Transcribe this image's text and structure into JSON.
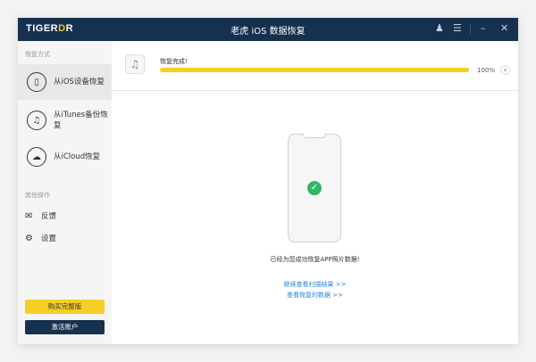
{
  "titlebar": {
    "logo": "TIGER",
    "logo_accent": "D",
    "logo_end": "R",
    "title": "老虎 iOS 数据恢复",
    "user_icon": "user-icon",
    "menu_icon": "menu-icon",
    "min": "–",
    "close": "✕"
  },
  "sidebar": {
    "section1": "恢复方式",
    "items": [
      {
        "label": "从iOS设备恢复",
        "icon": "phone-icon"
      },
      {
        "label": "从iTunes备份恢复",
        "icon": "music-icon"
      },
      {
        "label": "从iCloud恢复",
        "icon": "cloud-icon"
      }
    ],
    "section2": "其他操作",
    "ops": [
      {
        "label": "反馈"
      },
      {
        "label": "设置"
      }
    ],
    "buy": "购买完整版",
    "activate": "激活账户"
  },
  "progress": {
    "label": "恢复完成!",
    "percent": 100,
    "percent_text": "100%"
  },
  "result": {
    "message": "已经为您成功恢复APP照片数据!",
    "link1": "继续查看扫描结果 >>",
    "link2": "查看恢复的数据 >>"
  },
  "colors": {
    "navy": "#16304f",
    "yellow": "#f5cf1f",
    "green": "#2fb765",
    "link": "#2b84d8"
  }
}
